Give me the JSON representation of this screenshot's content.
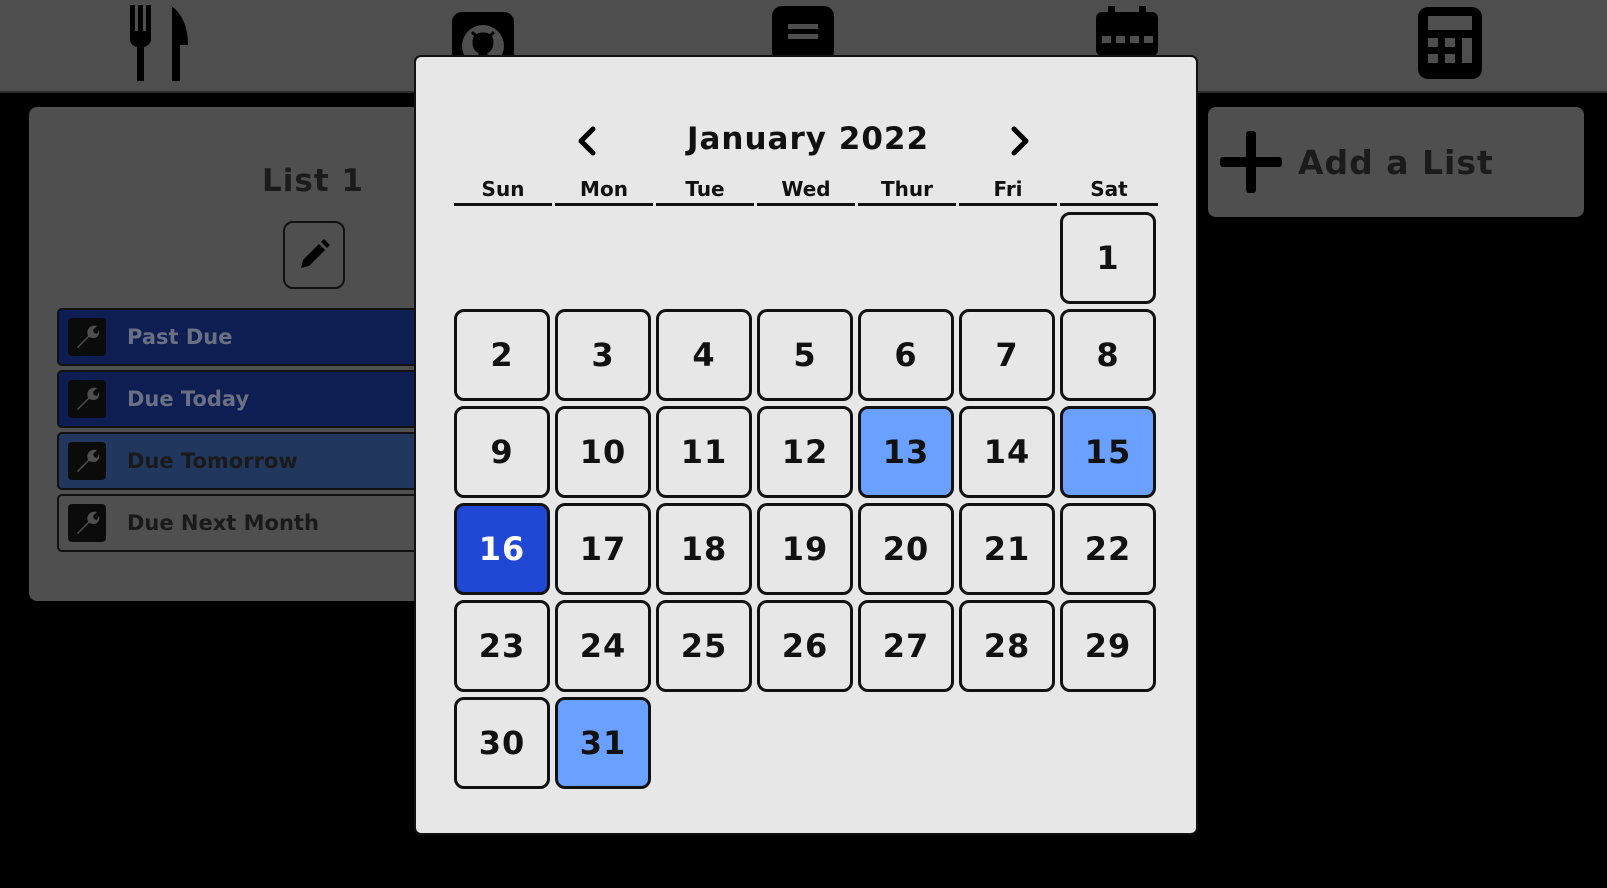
{
  "nav": {
    "icons": [
      "utensils-icon",
      "github-icon",
      "notes-icon",
      "calendar-icon",
      "calculator-icon"
    ]
  },
  "list": {
    "title": "List 1",
    "filters": [
      {
        "label": "Past Due",
        "bg": "#0e1e52",
        "text_color": "#6a7084"
      },
      {
        "label": "Due Today",
        "bg": "#0e1e52",
        "text_color": "#6a7084"
      },
      {
        "label": "Due Tomorrow",
        "bg": "#22375d",
        "text_color": "#1a1a1a"
      },
      {
        "label": "Due Next Month",
        "bg": "#4f4f4f",
        "text_color": "#1a1a1a"
      }
    ]
  },
  "add_list": {
    "label": "Add a List"
  },
  "calendar": {
    "month_label": "January 2022",
    "weekdays": [
      "Sun",
      "Mon",
      "Tue",
      "Wed",
      "Thur",
      "Fri",
      "Sat"
    ],
    "first_weekday_index": 6,
    "days_in_month": 31,
    "marked_days": [
      13,
      15,
      31
    ],
    "selected_day": 16,
    "colors": {
      "marked": "#6aa0ff",
      "selected": "#2048d4",
      "modal_bg": "#e7e7e7"
    }
  }
}
